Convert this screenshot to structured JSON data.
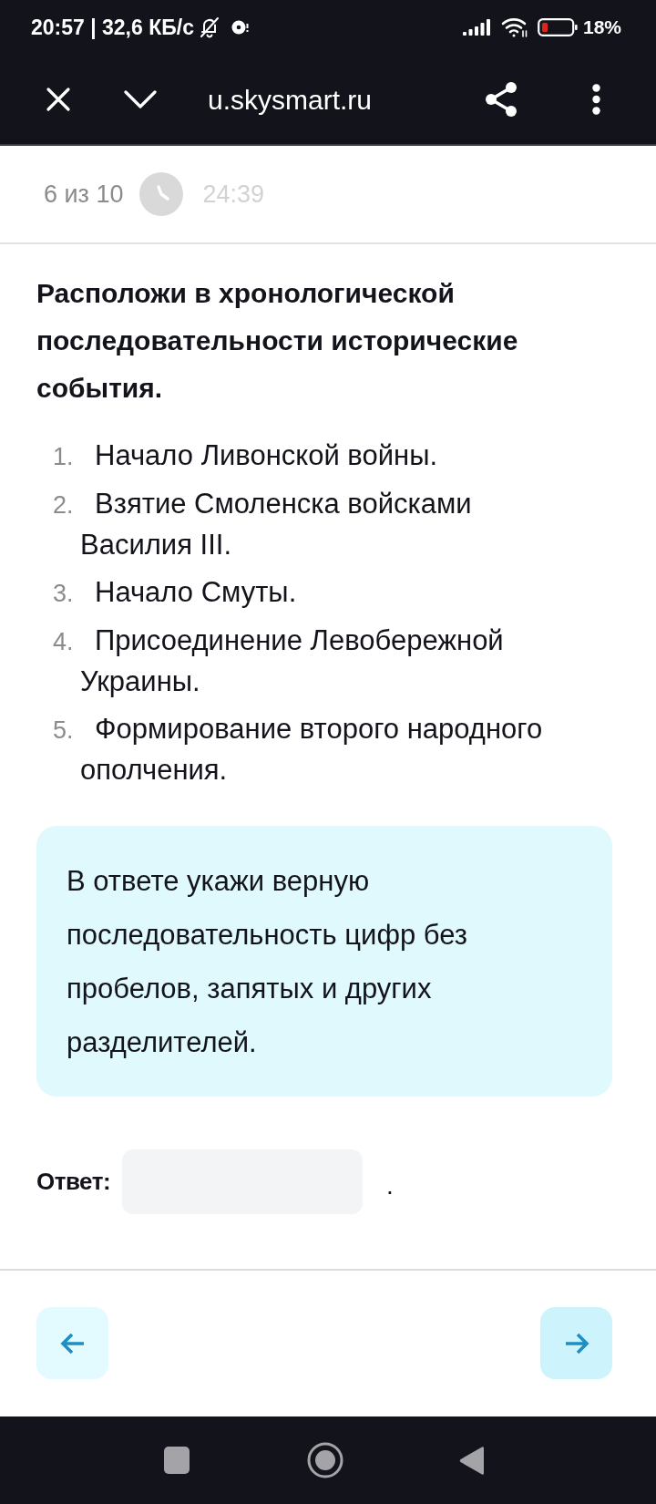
{
  "status_bar": {
    "left_text": "20:57 | 32,6 КБ/с",
    "battery": "18%"
  },
  "browser_bar": {
    "url": "u.skysmart.ru"
  },
  "progress": {
    "counter": "6 из 10",
    "timer": "24:39"
  },
  "question": {
    "title": "Расположи в хронологической последовательности исторические события.",
    "items": [
      {
        "number": "1.",
        "text": "Начало Ливонской войны."
      },
      {
        "number": "2.",
        "text": "Взятие Смоленска войсками Василия III."
      },
      {
        "number": "3.",
        "text": "Начало Смуты."
      },
      {
        "number": "4.",
        "text": "Присоединение Левобережной Украины."
      },
      {
        "number": "5.",
        "text": "Формирование второго народного ополчения."
      }
    ],
    "hint": "В ответе укажи верную последовательность цифр без пробелов, запятых и других разделителей."
  },
  "answer": {
    "label": "Ответ:",
    "trailing": "."
  },
  "navigation": [
    {
      "kind": "previous"
    },
    {
      "kind": "next"
    }
  ]
}
